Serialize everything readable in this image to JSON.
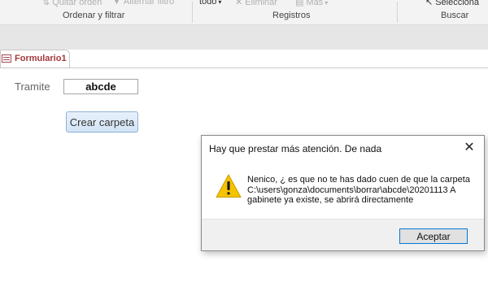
{
  "ribbon": {
    "commands": {
      "quitar_orden": "Quitar orden",
      "alternar_filtro": "Alternar filtro",
      "todo": "todo",
      "eliminar": "Eliminar",
      "mas": "Más",
      "seleccionar": "Selecciona"
    },
    "groups": {
      "ordenar": "Ordenar y filtrar",
      "registros": "Registros",
      "buscar": "Buscar"
    }
  },
  "tab": {
    "label": "Formulario1"
  },
  "form": {
    "tramite_label": "Tramite",
    "tramite_value": "abcde",
    "crear_button": "Crear carpeta"
  },
  "dialog": {
    "title": "Hay que prestar más atención. De nada",
    "message_lines": [
      "Nenico, ¿ es que no te has dado cuen de que la carpeta",
      "C:\\users\\gonza\\documents\\borrar\\abcde\\20201113 A",
      "gabinete ya existe, se abrirá directamente"
    ],
    "ok_button": "Aceptar"
  },
  "colors": {
    "tab_accent": "#a4373a",
    "button_border": "#0078d7",
    "warning": "#f5c400"
  }
}
